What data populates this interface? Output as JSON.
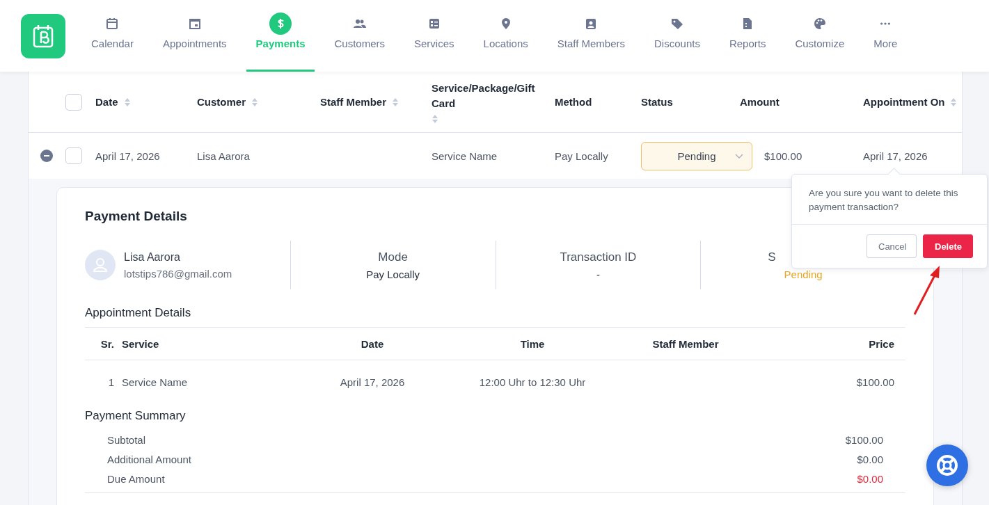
{
  "nav": {
    "items": [
      {
        "label": "Calendar",
        "selected": false
      },
      {
        "label": "Appointments",
        "selected": false
      },
      {
        "label": "Payments",
        "selected": true
      },
      {
        "label": "Customers",
        "selected": false
      },
      {
        "label": "Services",
        "selected": false
      },
      {
        "label": "Locations",
        "selected": false
      },
      {
        "label": "Staff Members",
        "selected": false
      },
      {
        "label": "Discounts",
        "selected": false
      },
      {
        "label": "Reports",
        "selected": false
      },
      {
        "label": "Customize",
        "selected": false
      },
      {
        "label": "More",
        "selected": false
      }
    ]
  },
  "table": {
    "select_all_checked": false,
    "columns": [
      {
        "label": "Date",
        "sortable": true
      },
      {
        "label": "Customer",
        "sortable": true
      },
      {
        "label": "Staff Member",
        "sortable": true
      },
      {
        "label": "Service/Package/Gift Card",
        "sortable": true
      },
      {
        "label": "Method",
        "sortable": false
      },
      {
        "label": "Status",
        "sortable": false
      },
      {
        "label": "Amount",
        "sortable": false
      },
      {
        "label": "Appointment On",
        "sortable": true
      }
    ],
    "rows": [
      {
        "expanded": true,
        "checked": false,
        "date": "April 17, 2026",
        "customer": "Lisa Aarora",
        "service": "Service Name",
        "method": "Pay Locally",
        "status": "Pending",
        "amount": "$100.00",
        "appointment_on": "April 17, 2026"
      }
    ]
  },
  "details": {
    "title": "Payment Details",
    "customer": {
      "name": "Lisa Aarora",
      "email": "lotstips786@gmail.com"
    },
    "info": [
      {
        "label": "Mode",
        "value": "Pay Locally",
        "kind": "plain"
      },
      {
        "label": "Transaction ID",
        "value": "-",
        "kind": "plain"
      },
      {
        "label": "S",
        "value": "Pending",
        "kind": "status"
      }
    ],
    "appointment_title": "Appointment Details",
    "appointment_columns": [
      "Sr.",
      "Service",
      "Date",
      "Time",
      "Staff Member",
      "Price"
    ],
    "appointment_rows": [
      {
        "sr": "1",
        "service": "Service Name",
        "date": "April 17, 2026",
        "time": "12:00 Uhr to 12:30 Uhr",
        "price": "$100.00"
      }
    ],
    "summary_title": "Payment Summary",
    "summary": [
      {
        "label": "Subtotal",
        "value": "$100.00",
        "kind": "plain"
      },
      {
        "label": "Additional Amount",
        "value": "$0.00",
        "kind": "plain"
      },
      {
        "label": "Due Amount",
        "value": "$0.00",
        "kind": "due"
      }
    ]
  },
  "popover": {
    "message": "Are you sure you want to delete this payment transaction?",
    "buttons": [
      {
        "label": "Cancel",
        "kind": "secondary"
      },
      {
        "label": "Delete",
        "kind": "danger"
      }
    ]
  }
}
